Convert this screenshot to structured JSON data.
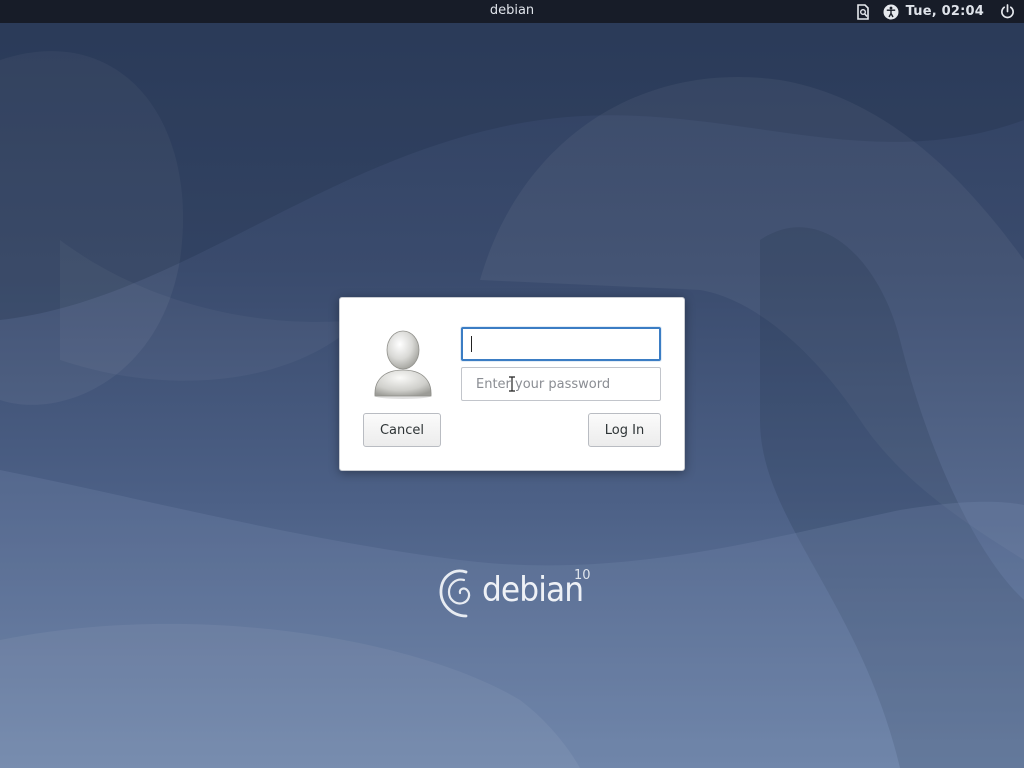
{
  "topbar": {
    "hostname": "debian",
    "clock": "Tue, 02:04",
    "icons": [
      "keyboard-layout-icon",
      "accessibility-icon",
      "power-icon"
    ]
  },
  "login": {
    "username_value": "",
    "password_placeholder": "Enter your password",
    "cancel_label": "Cancel",
    "login_label": "Log In"
  },
  "branding": {
    "logo_text": "debian",
    "version": "10"
  },
  "colors": {
    "focus_accent": "#3b7dc4",
    "topbar_bg": "#161a24",
    "wallpaper_base": "#3a4b6d"
  }
}
